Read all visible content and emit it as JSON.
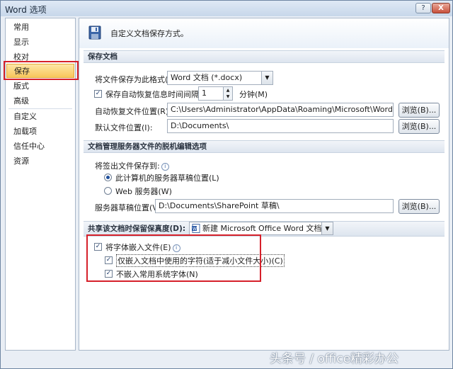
{
  "window": {
    "title": "Word 选项",
    "help_label": "?",
    "close_label": "X"
  },
  "sidebar": {
    "items": [
      {
        "label": "常用"
      },
      {
        "label": "显示"
      },
      {
        "label": "校对"
      },
      {
        "label": "保存"
      },
      {
        "label": "版式"
      },
      {
        "label": "高级"
      },
      {
        "label": "自定义"
      },
      {
        "label": "加载项"
      },
      {
        "label": "信任中心"
      },
      {
        "label": "资源"
      }
    ],
    "selected": "保存"
  },
  "header": {
    "title": "自定义文档保存方式。",
    "icon": "floppy-disk-icon"
  },
  "save_docs": {
    "section_title": "保存文档",
    "format_label": "将文件保存为此格式(F):",
    "format_value": "Word 文档 (*.docx)",
    "autorecover_label": "保存自动恢复信息时间间隔(A)",
    "autorecover_checked": true,
    "autorecover_value": "1",
    "minutes_label": "分钟(M)",
    "autorecover_path_label": "自动恢复文件位置(R):",
    "autorecover_path_value": "C:\\Users\\Administrator\\AppData\\Roaming\\Microsoft\\Word\\",
    "default_path_label": "默认文件位置(I):",
    "default_path_value": "D:\\Documents\\",
    "browse_label": "浏览(B)..."
  },
  "offline": {
    "section_title": "文档管理服务器文件的脱机编辑选项",
    "checkout_label": "将签出文件保存到:",
    "option_server_drafts": "此计算机的服务器草稿位置(L)",
    "option_web_server": "Web 服务器(W)",
    "selected_option": "此计算机的服务器草稿位置(L)",
    "drafts_path_label": "服务器草稿位置(V):",
    "drafts_path_value": "D:\\Documents\\SharePoint 草稿\\",
    "browse_label": "浏览(B)..."
  },
  "fidelity": {
    "section_title": "共享该文档时保留保真度(D):",
    "document_value": "新建 Microsoft Office Word 文档.docx",
    "embed_fonts_label": "将字体嵌入文件(E)",
    "embed_fonts_checked": true,
    "embed_used_chars_label": "仅嵌入文档中使用的字符(适于减小文件大小)(C)",
    "embed_used_chars_checked": true,
    "no_common_fonts_label": "不嵌入常用系统字体(N)",
    "no_common_fonts_checked": true
  },
  "watermark": {
    "text": "头条号 / office精彩办公"
  },
  "colors": {
    "highlight": "#d6202a",
    "selection": "#f8c55b"
  }
}
